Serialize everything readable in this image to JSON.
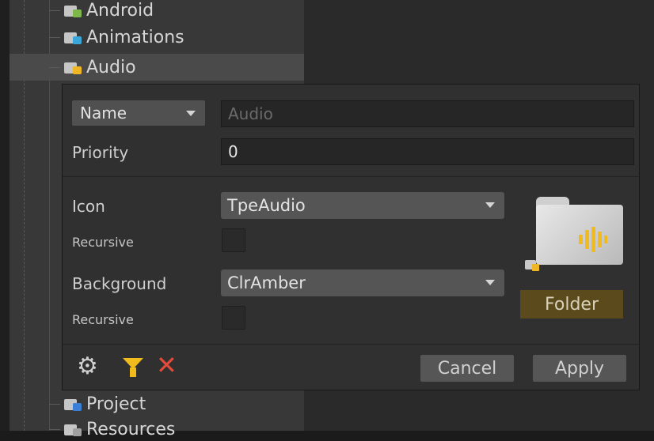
{
  "tree": {
    "items": [
      {
        "label": "Android",
        "icon": "android-folder-icon",
        "badge_color": "#7fb84a"
      },
      {
        "label": "Animations",
        "icon": "animations-folder-icon",
        "badge_color": "#3aa7d8"
      },
      {
        "label": "Audio",
        "icon": "audio-folder-icon",
        "badge_color": "#f0b623"
      },
      {
        "label": "Project",
        "icon": "project-folder-icon",
        "badge_color": "#3b7fd6"
      },
      {
        "label": "Resources",
        "icon": "resources-folder-icon",
        "badge_color": "#a0a0a0"
      }
    ],
    "selected_index": 2
  },
  "inspector": {
    "match_mode": "Name",
    "name_placeholder": "Audio",
    "priority_label": "Priority",
    "priority_value": "0",
    "icon_label": "Icon",
    "icon_value": "TpeAudio",
    "icon_recursive_label": "Recursive",
    "background_label": "Background",
    "background_value": "ClrAmber",
    "background_recursive_label": "Recursive",
    "preview_button_label": "Folder",
    "cancel_label": "Cancel",
    "apply_label": "Apply"
  },
  "colors": {
    "amber": "#f1bb1e",
    "remove_red": "#e44b3a",
    "preview_bg": "#5a4a1c"
  }
}
